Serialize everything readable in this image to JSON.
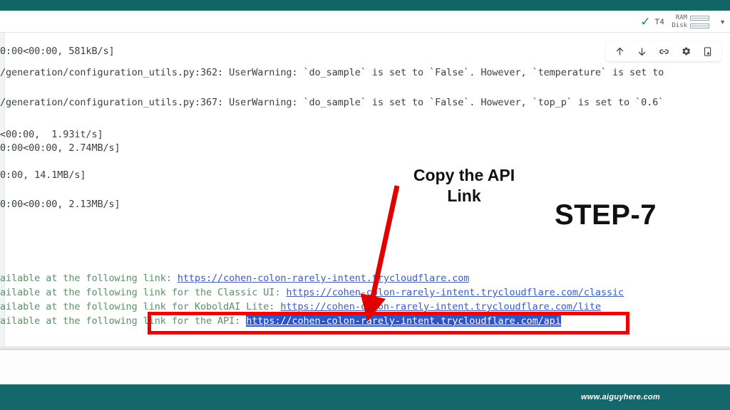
{
  "window": {
    "top_bar_color": "#126565",
    "bottom_bar_color": "#14676a"
  },
  "footer": {
    "watermark": "www.aiguyhere.com"
  },
  "status_bar": {
    "connected_icon": "check-icon",
    "accelerator": "T4",
    "resources": [
      {
        "label": "RAM"
      },
      {
        "label": "Disk"
      }
    ],
    "dropdown_icon": "chevron-down-icon"
  },
  "cell_toolbar": {
    "items": [
      {
        "icon": "arrow-up-icon",
        "name": "move-cell-up-button"
      },
      {
        "icon": "arrow-down-icon",
        "name": "move-cell-down-button"
      },
      {
        "icon": "link-icon",
        "name": "copy-cell-link-button"
      },
      {
        "icon": "gear-icon",
        "name": "cell-settings-button"
      },
      {
        "icon": "copy-to-drive-icon",
        "name": "copy-to-drive-button"
      }
    ]
  },
  "output": {
    "lines": [
      "0:00<00:00, 581kB/s]",
      "/generation/configuration_utils.py:362: UserWarning: `do_sample` is set to `False`. However, `temperature` is set to",
      "/generation/configuration_utils.py:367: UserWarning: `do_sample` is set to `False`. However, `top_p` is set to `0.6`",
      "<00:00,  1.93it/s]",
      "0:00<00:00, 2.74MB/s]",
      "0:00, 14.1MB/s]",
      "0:00<00:00, 2.13MB/s]"
    ],
    "link_lines": [
      {
        "prefix": "ailable at the following link: ",
        "url": "https://cohen-colon-rarely-intent.trycloudflare.com",
        "selected": false
      },
      {
        "prefix": "ailable at the following link for the Classic UI: ",
        "url": "https://cohen-colon-rarely-intent.trycloudflare.com/classic",
        "selected": false
      },
      {
        "prefix": "ailable at the following link for KoboldAI Lite: ",
        "url": "https://cohen-colon-rarely-intent.trycloudflare.com/lite",
        "selected": false
      },
      {
        "prefix": "ailable at the following link for the API: ",
        "url": "https://cohen-colon-rarely-intent.trycloudflare.com/api",
        "selected": true
      }
    ]
  },
  "annotations": {
    "callout_text": "Copy the API Link",
    "step_label": "STEP-7",
    "arrow_color": "#e00000",
    "highlight_box_color": "#ee0000"
  }
}
